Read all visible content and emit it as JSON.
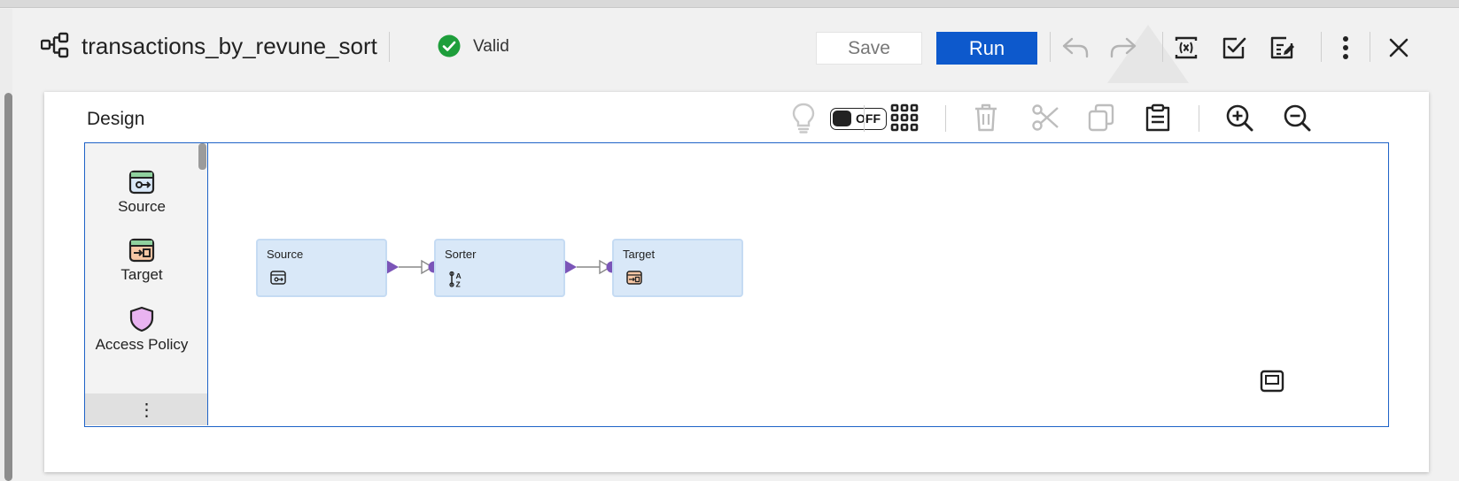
{
  "header": {
    "title": "transactions_by_revune_sort",
    "status": "Valid",
    "save_label": "Save",
    "run_label": "Run",
    "icons": [
      "mapping-icon",
      "valid-check-icon",
      "undo-icon",
      "redo-icon",
      "parameters-icon",
      "validate-icon",
      "properties-icon",
      "more-vertical-icon",
      "close-icon"
    ]
  },
  "design": {
    "title": "Design",
    "toggle_label": "OFF",
    "toolbar_icons": [
      "lightbulb-icon",
      "grid-icon",
      "delete-icon",
      "cut-icon",
      "copy-icon",
      "paste-icon",
      "zoom-in-icon",
      "zoom-out-icon"
    ]
  },
  "palette": {
    "items": [
      {
        "label": "Source",
        "icon": "source-icon"
      },
      {
        "label": "Target",
        "icon": "target-icon"
      },
      {
        "label": "Access Policy",
        "icon": "access-policy-icon"
      }
    ],
    "more_label": "⋮"
  },
  "canvas": {
    "nodes": [
      {
        "label": "Source",
        "icon": "source-icon"
      },
      {
        "label": "Sorter",
        "icon": "sorter-icon"
      },
      {
        "label": "Target",
        "icon": "target-icon"
      }
    ]
  },
  "colors": {
    "run_button": "#0d59cc",
    "valid": "#1e9e3b",
    "canvas_border": "#1f63c7",
    "node_fill": "#d9e8f8",
    "connector": "#7b55b8"
  }
}
